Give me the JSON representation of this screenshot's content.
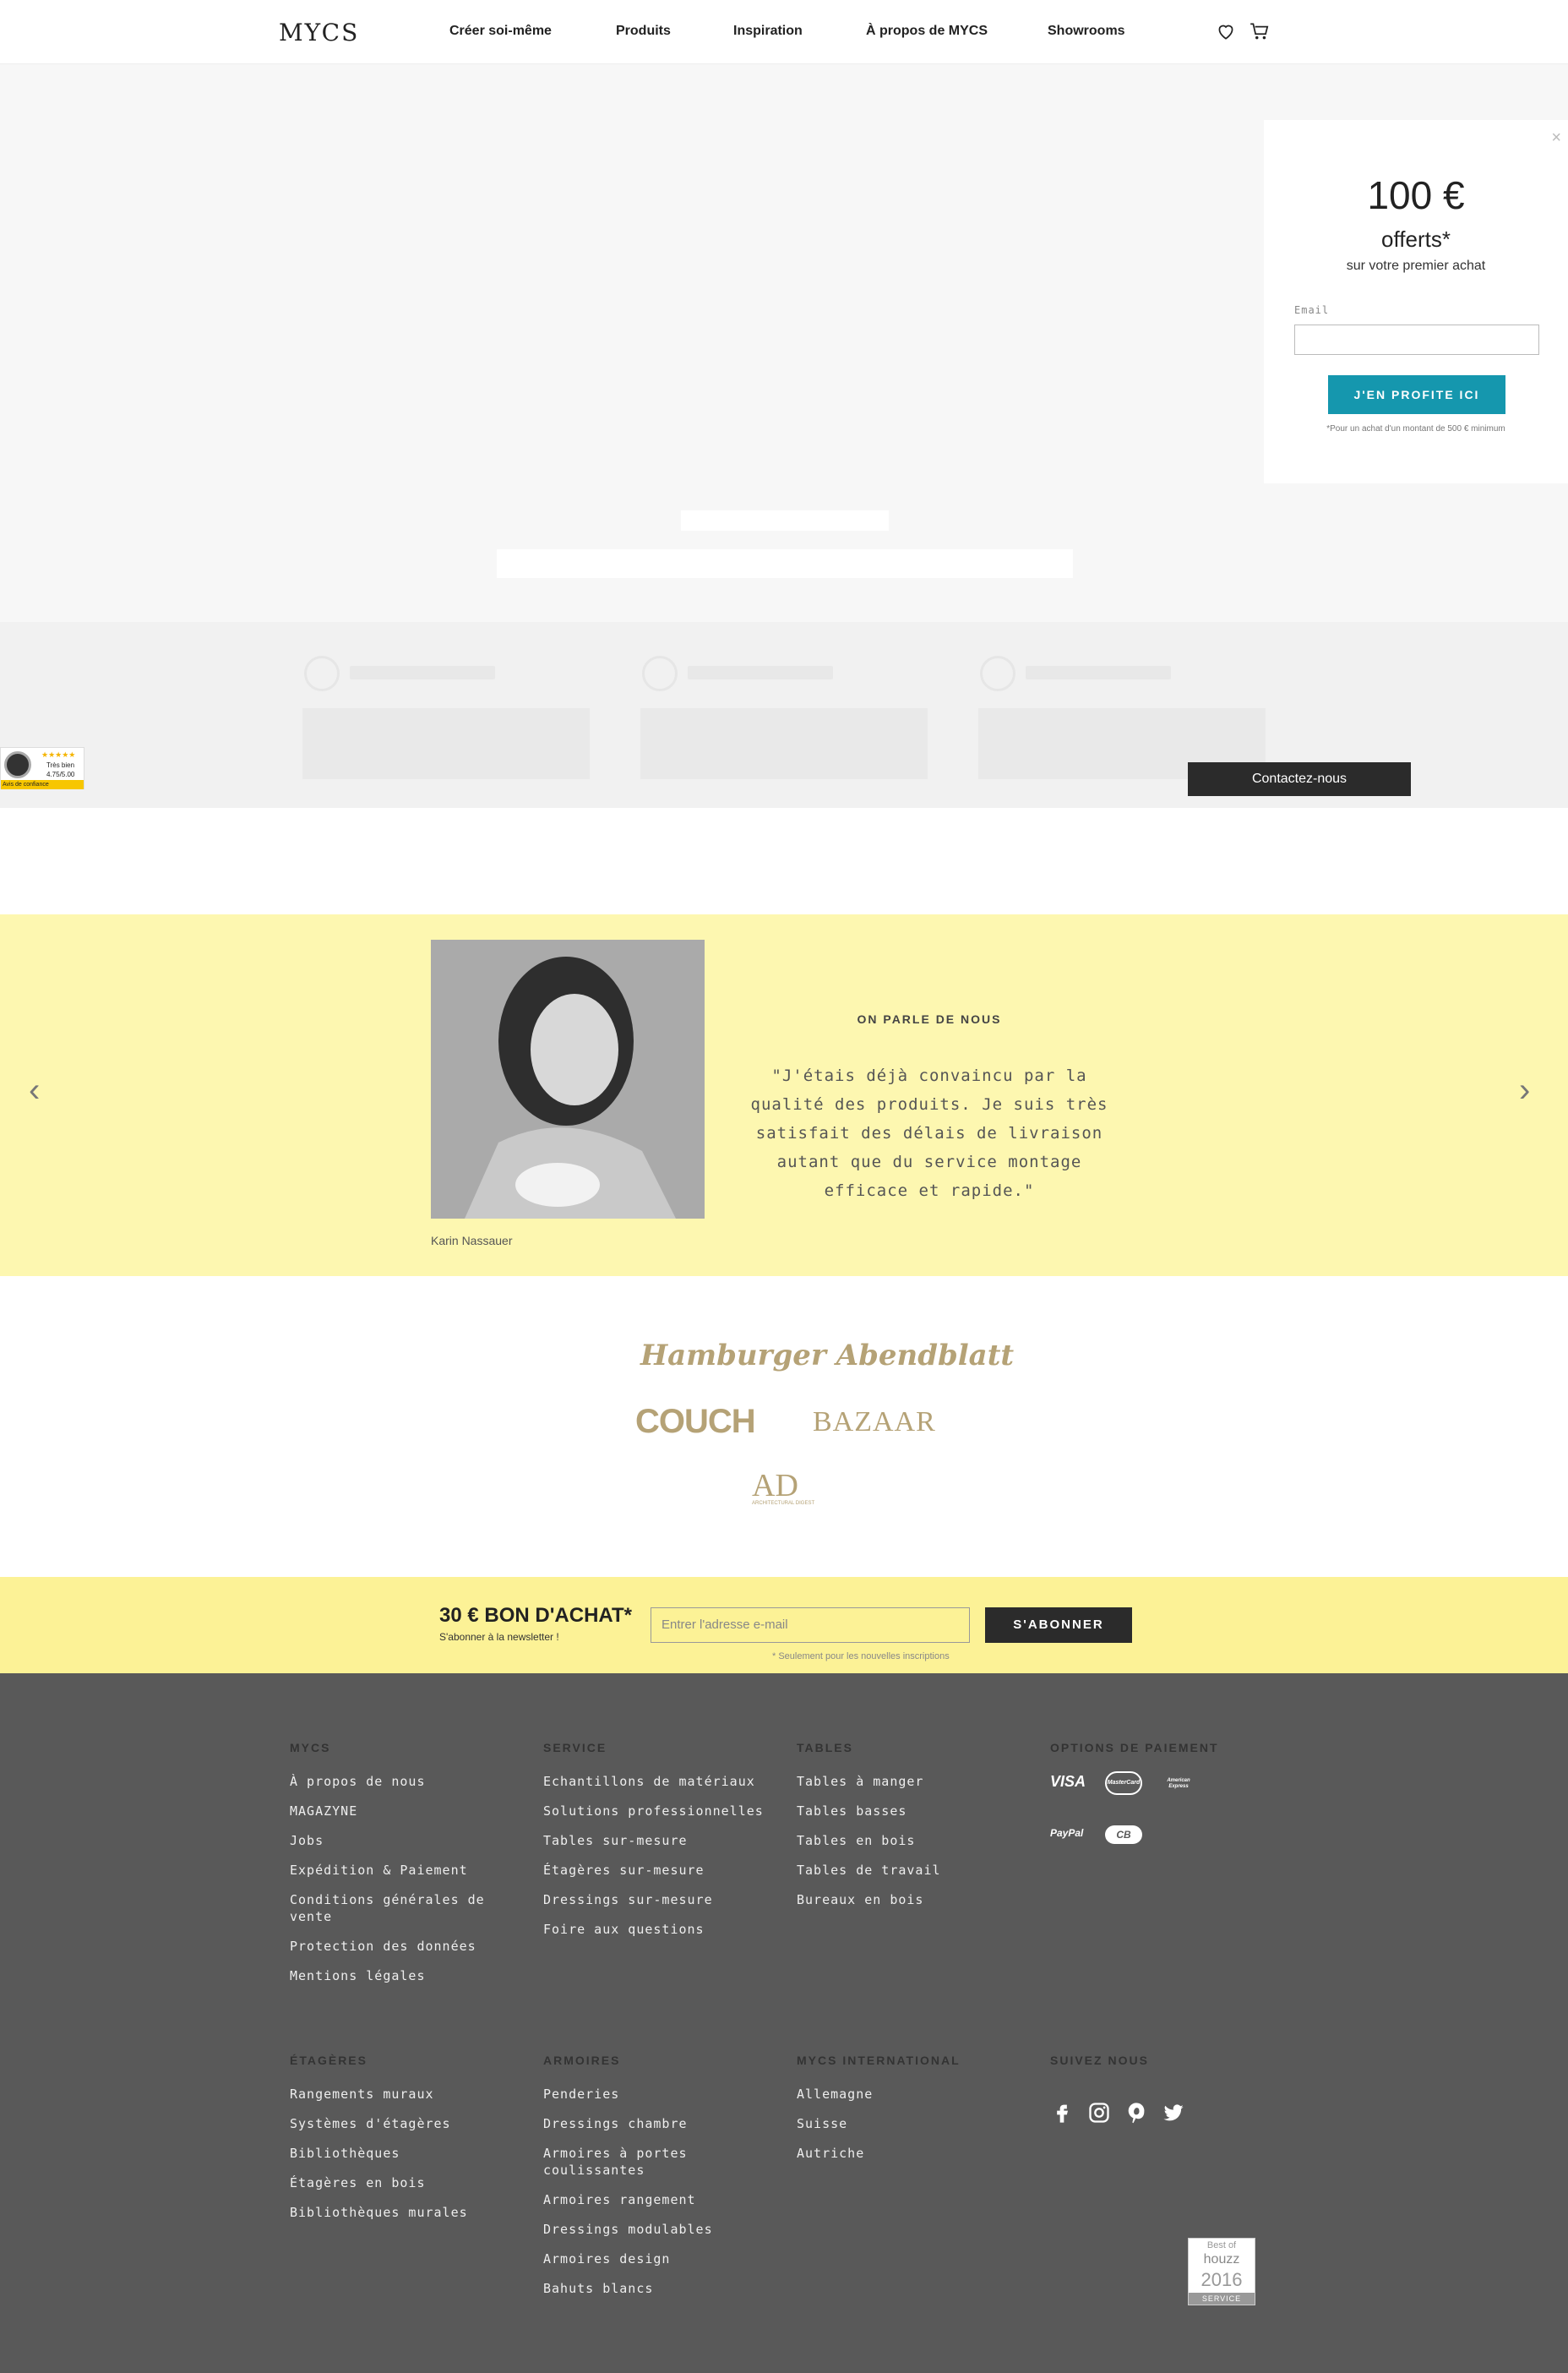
{
  "header": {
    "logo": "MYCS",
    "nav": [
      "Créer soi-même",
      "Produits",
      "Inspiration",
      "À propos de MYCS",
      "Showrooms"
    ],
    "icons": [
      "heart-icon",
      "cart-icon"
    ]
  },
  "popup": {
    "amount": "100 €",
    "offered": "offerts*",
    "subtitle": "sur votre premier achat",
    "email_label": "Email",
    "cta": "J'EN PROFITE ICI",
    "fine_print": "*Pour un achat d'un montant de 500 € minimum",
    "accent": "#1597ae"
  },
  "trust_badge": {
    "rating_text": "Très bien",
    "score": "4.75/5.00",
    "footer": "Avis de confiance"
  },
  "contact_button": "Contactez-nous",
  "testimonial": {
    "title": "ON PARLE DE NOUS",
    "quote": "\"J'étais déjà convaincu par la qualité des produits. Je suis très satisfait des délais de livraison autant que du service montage efficace et rapide.\"",
    "author": "Karin Nassauer",
    "bg": "#fdf7b0"
  },
  "press": {
    "logos": [
      "Hamburger Abendblatt",
      "COUCH",
      "BAZAAR",
      "AD"
    ],
    "ad_sub": "ARCHITECTURAL DIGEST"
  },
  "newsletter": {
    "title": "30 € BON D'ACHAT*",
    "subtitle": "S'abonner à la newsletter !",
    "placeholder": "Entrer l'adresse e-mail",
    "button": "S'ABONNER",
    "fine_print": "* Seulement pour les nouvelles inscriptions",
    "bg": "#fcf296"
  },
  "footer": {
    "bg": "#595959",
    "columns_top": [
      {
        "title": "MYCS",
        "items": [
          "À propos de nous",
          "MAGAZYNE",
          "Jobs",
          "Expédition & Paiement",
          "Conditions générales de vente",
          "Protection des données",
          "Mentions légales"
        ]
      },
      {
        "title": "SERVICE",
        "items": [
          "Echantillons de matériaux",
          "Solutions professionnelles",
          "Tables sur-mesure",
          "Étagères sur-mesure",
          "Dressings sur-mesure",
          "Foire aux questions"
        ]
      },
      {
        "title": "TABLES",
        "items": [
          "Tables à manger",
          "Tables basses",
          "Tables en bois",
          "Tables de travail",
          "Bureaux en bois"
        ]
      },
      {
        "title": "OPTIONS DE PAIEMENT",
        "items": []
      }
    ],
    "columns_bottom": [
      {
        "title": "ÉTAGÈRES",
        "items": [
          "Rangements muraux",
          "Systèmes d'étagères",
          "Bibliothèques",
          "Étagères en bois",
          "Bibliothèques murales"
        ]
      },
      {
        "title": "ARMOIRES",
        "items": [
          "Penderies",
          "Dressings chambre",
          "Armoires à portes coulissantes",
          "Armoires rangement",
          "Dressings modulables",
          "Armoires design",
          "Bahuts blancs"
        ]
      },
      {
        "title": "MYCS INTERNATIONAL",
        "items": [
          "Allemagne",
          "Suisse",
          "Autriche"
        ]
      },
      {
        "title": "SUIVEZ NOUS",
        "items": []
      }
    ],
    "payment": [
      "VISA",
      "MasterCard",
      "American Express",
      "PayPal",
      "CB"
    ],
    "social": [
      "facebook-icon",
      "instagram-icon",
      "pinterest-icon",
      "twitter-icon"
    ],
    "houzz": {
      "line1": "Best of",
      "line2": "houzz",
      "year": "2016",
      "label": "SERVICE"
    }
  }
}
